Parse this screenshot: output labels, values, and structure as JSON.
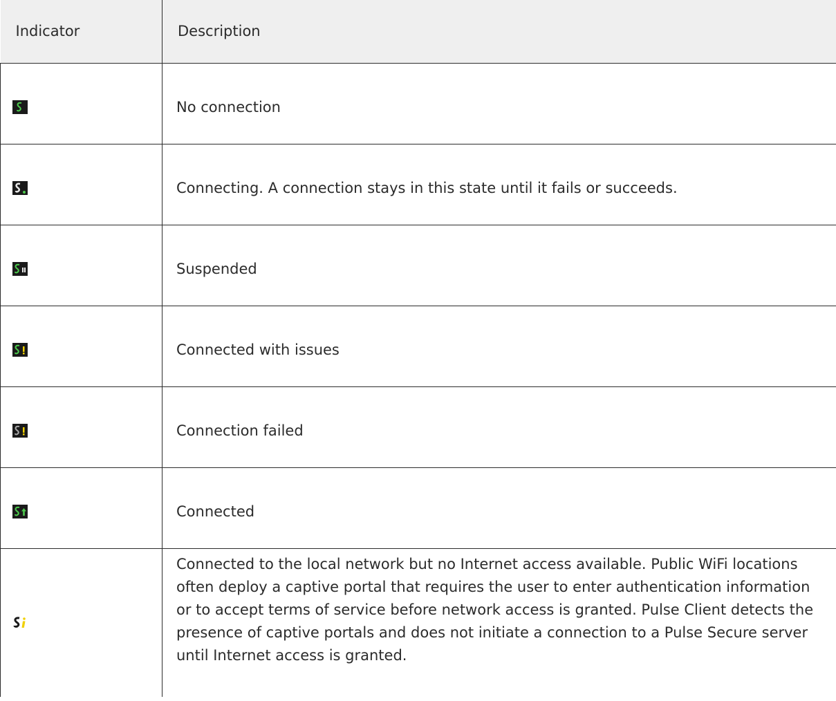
{
  "table": {
    "headers": {
      "indicator": "Indicator",
      "description": "Description"
    },
    "rows": [
      {
        "icon": "pulse-s-icon",
        "badge": "none",
        "description": "No connection"
      },
      {
        "icon": "pulse-s-icon",
        "badge": "green-dot",
        "description": "Connecting. A connection stays in this state until it fails or succeeds."
      },
      {
        "icon": "pulse-s-icon",
        "badge": "pause",
        "description": "Suspended"
      },
      {
        "icon": "pulse-s-icon",
        "badge": "exclamation",
        "description": "Connected with issues"
      },
      {
        "icon": "pulse-s-icon",
        "badge": "exclamation-gray",
        "description": "Connection failed"
      },
      {
        "icon": "pulse-s-icon",
        "badge": "up-arrow",
        "description": "Connected"
      },
      {
        "icon": "pulse-s-icon",
        "badge": "info",
        "description": "Connected to the local network but no Internet access available. Public WiFi locations often deploy a captive portal that requires the user to enter authentication information or to accept terms of service before network access is granted. Pulse Client detects the presence of captive portals and does not initiate a connection to a Pulse Secure server until Internet access is granted."
      }
    ]
  },
  "colors": {
    "header_bg": "#efefef",
    "border": "#2b2b2b",
    "icon_bg": "#1a1a1a",
    "icon_green": "#4cc94c",
    "icon_yellow": "#f0d000"
  }
}
